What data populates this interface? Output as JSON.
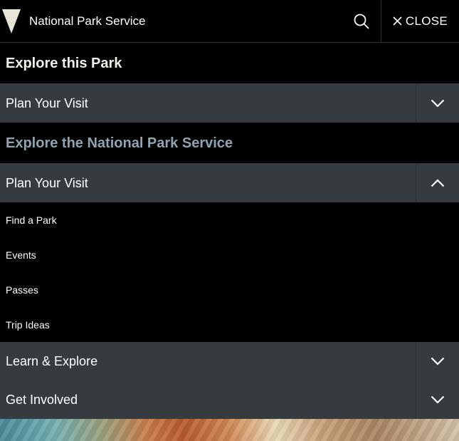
{
  "header": {
    "site_title": "National Park Service",
    "close_label": "CLOSE"
  },
  "menu": {
    "explore_park_heading": "Explore this Park",
    "park_plan_visit": "Plan Your Visit",
    "explore_nps_heading": "Explore the National Park Service",
    "nps_plan_visit": "Plan Your Visit",
    "nps_plan_visit_links": [
      "Find a Park",
      "Events",
      "Passes",
      "Trip Ideas"
    ],
    "learn_explore": "Learn & Explore",
    "get_involved": "Get Involved"
  },
  "colors": {
    "background": "#000000",
    "accordion": "#363b40",
    "heading_park": "#f0efe8",
    "heading_nps": "#90a4b0",
    "logo": "#e8e6d6"
  },
  "icons": {
    "logo": "arrowhead-logo",
    "search": "search-icon",
    "close": "close-icon",
    "expand": "chevron-down-icon",
    "collapse": "chevron-up-icon"
  }
}
